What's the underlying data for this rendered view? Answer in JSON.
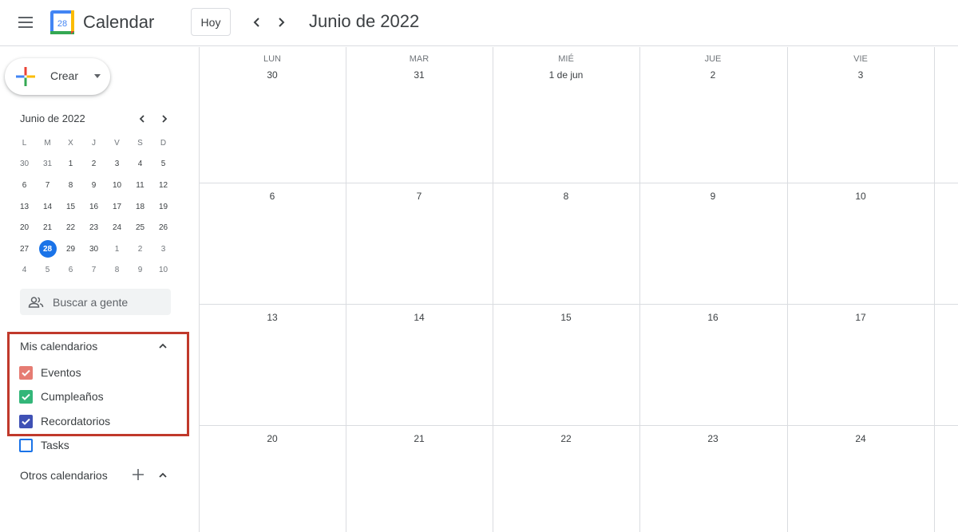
{
  "header": {
    "app_title": "Calendar",
    "logo_day": "28",
    "today_label": "Hoy",
    "current_period": "Junio de 2022"
  },
  "sidebar": {
    "create_label": "Crear",
    "mini_calendar": {
      "title": "Junio de 2022",
      "weekday_headers": [
        "L",
        "M",
        "X",
        "J",
        "V",
        "S",
        "D"
      ],
      "weeks": [
        [
          "30",
          "31",
          "1",
          "2",
          "3",
          "4",
          "5"
        ],
        [
          "6",
          "7",
          "8",
          "9",
          "10",
          "11",
          "12"
        ],
        [
          "13",
          "14",
          "15",
          "16",
          "17",
          "18",
          "19"
        ],
        [
          "20",
          "21",
          "22",
          "23",
          "24",
          "25",
          "26"
        ],
        [
          "27",
          "28",
          "29",
          "30",
          "1",
          "2",
          "3"
        ],
        [
          "4",
          "5",
          "6",
          "7",
          "8",
          "9",
          "10"
        ]
      ],
      "today": "28"
    },
    "people_search_placeholder": "Buscar a gente",
    "my_calendars": {
      "title": "Mis calendarios",
      "items": [
        {
          "label": "Eventos",
          "checked": true,
          "color": "#e67c73"
        },
        {
          "label": "Cumpleaños",
          "checked": true,
          "color": "#33b679"
        },
        {
          "label": "Recordatorios",
          "checked": true,
          "color": "#3f51b5"
        },
        {
          "label": "Tasks",
          "checked": false,
          "color": "#1a73e8"
        }
      ]
    },
    "other_calendars": {
      "title": "Otros calendarios"
    }
  },
  "month_view": {
    "day_headers": [
      "LUN",
      "MAR",
      "MIÉ",
      "JUE",
      "VIE"
    ],
    "weeks": [
      [
        "30",
        "31",
        "1 de jun",
        "2",
        "3"
      ],
      [
        "6",
        "7",
        "8",
        "9",
        "10"
      ],
      [
        "13",
        "14",
        "15",
        "16",
        "17"
      ],
      [
        "20",
        "21",
        "22",
        "23",
        "24"
      ]
    ]
  },
  "colors": {
    "accent": "#1a73e8",
    "highlight_border": "#c0392b",
    "grid_line": "#dadce0"
  }
}
